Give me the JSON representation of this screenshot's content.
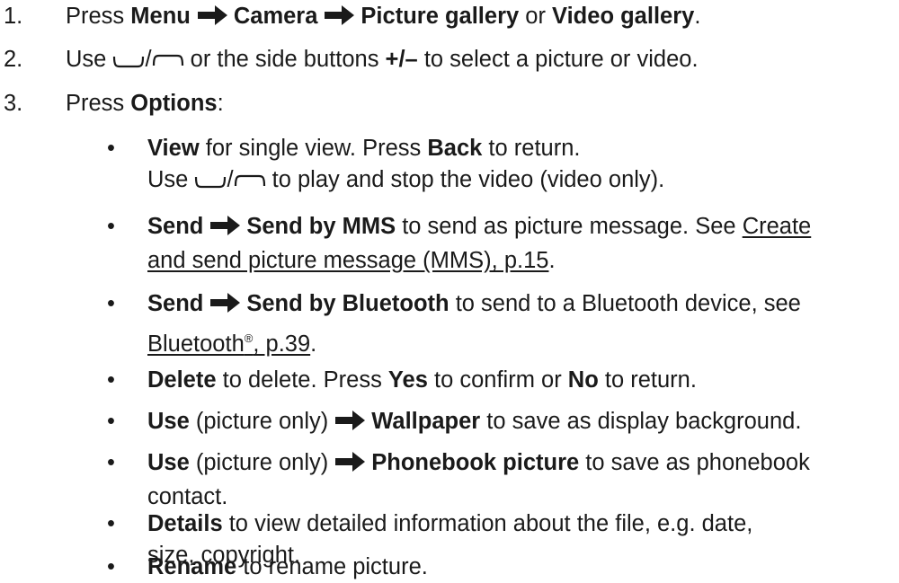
{
  "steps": [
    {
      "num": "1.",
      "press": "Press",
      "menu": "Menu",
      "camera": "Camera",
      "picture_gallery": "Picture gallery",
      "or": "or",
      "video_gallery": "Video gallery",
      "end": "."
    },
    {
      "num": "2.",
      "use": "Use",
      "slash": "/",
      "or_side": "or the side buttons",
      "plusminus": "+/–",
      "rest": "to select a picture or video."
    },
    {
      "num": "3.",
      "press": "Press",
      "options": "Options",
      "colon": ":"
    }
  ],
  "bullets": [
    {
      "symbol": "•",
      "view": "View",
      "view_text": "for single view. Press",
      "back": "Back",
      "back_text": "to return.",
      "use": "Use",
      "slash": "/",
      "play_text": "to play and stop the video (video only)."
    },
    {
      "symbol": "•",
      "send": "Send",
      "send_mms": "Send by MMS",
      "mms_text": "to send as picture message. See",
      "link_part1": "Create",
      "link_part2": "and send picture message (MMS), p.15",
      "end": "."
    },
    {
      "symbol": "•",
      "send": "Send",
      "send_bt": "Send by Bluetooth",
      "bt_text": "to send to a Bluetooth device, see",
      "link_bluetooth": "Bluetooth",
      "link_reg": "®",
      "link_page": ", p.39",
      "end": "."
    },
    {
      "symbol": "•",
      "delete": "Delete",
      "delete_text": "to delete. Press",
      "yes": "Yes",
      "confirm_text": "to confirm or",
      "no": "No",
      "return_text": "to return."
    },
    {
      "symbol": "•",
      "use": "Use",
      "picture_only": "(picture only)",
      "wallpaper": "Wallpaper",
      "wallpaper_text": "to save as display background."
    },
    {
      "symbol": "•",
      "use": "Use",
      "picture_only": "(picture only)",
      "phonebook_picture": "Phonebook picture",
      "phonebook_text": "to save as phonebook",
      "phonebook_text2": "contact."
    },
    {
      "symbol": "•",
      "details": "Details",
      "details_text": "to view detailed information about the file, e.g. date,",
      "details_text2": "size, copyright."
    },
    {
      "symbol": "•",
      "rename": "Rename",
      "rename_text": "to rename picture."
    }
  ]
}
